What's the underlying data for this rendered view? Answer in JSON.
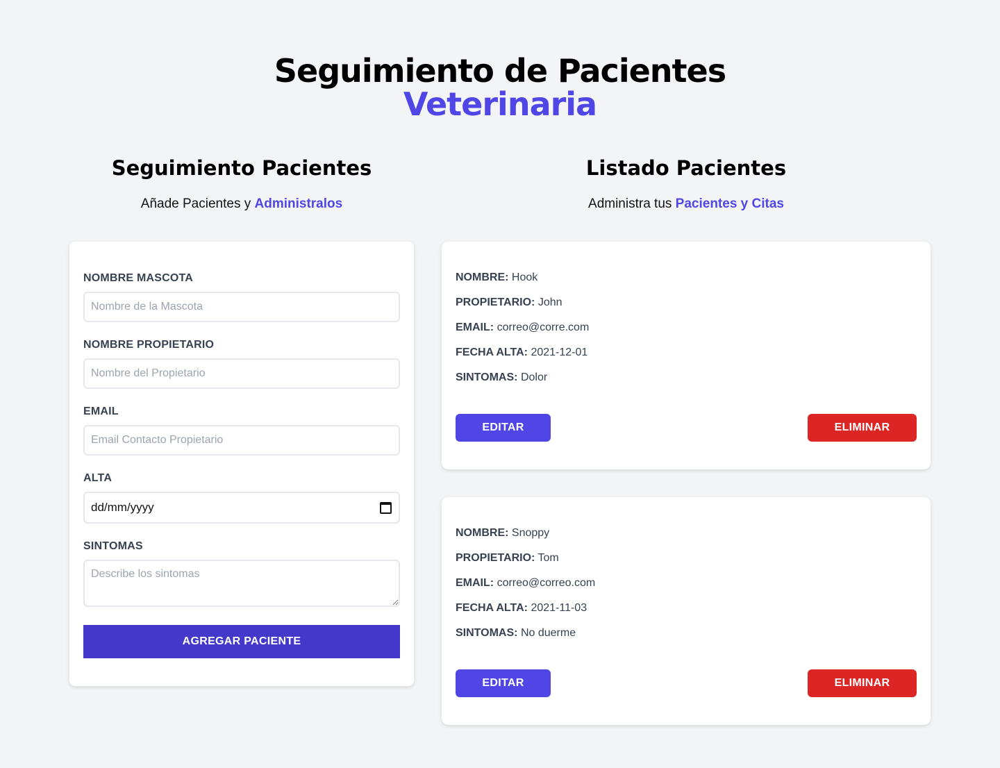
{
  "header": {
    "title_line1": "Seguimiento de Pacientes",
    "title_line2": "Veterinaria"
  },
  "form_section": {
    "title": "Seguimiento Pacientes",
    "subtitle_prefix": "Añade Pacientes y ",
    "subtitle_highlight": "Administralos"
  },
  "list_section": {
    "title": "Listado Pacientes",
    "subtitle_prefix": "Administra tus ",
    "subtitle_highlight": "Pacientes y Citas"
  },
  "form": {
    "pet_label": "NOMBRE MASCOTA",
    "pet_placeholder": "Nombre de la Mascota",
    "owner_label": "NOMBRE PROPIETARIO",
    "owner_placeholder": "Nombre del Propietario",
    "email_label": "EMAIL",
    "email_placeholder": "Email Contacto Propietario",
    "date_label": "ALTA",
    "date_value": "dd/mm/yyyy",
    "symptoms_label": "SINTOMAS",
    "symptoms_placeholder": "Describe los sintomas",
    "submit_label": "AGREGAR PACIENTE"
  },
  "field_keys": {
    "name": "Nombre:",
    "owner": "Propietario:",
    "email": "Email:",
    "date": "Fecha Alta:",
    "symptoms": "Sintomas:"
  },
  "patients": [
    {
      "name": "Hook",
      "owner": "John",
      "email": "correo@corre.com",
      "date": "2021-12-01",
      "symptoms": "Dolor",
      "edit_label": "Editar",
      "delete_label": "Eliminar"
    },
    {
      "name": "Snoppy",
      "owner": "Tom",
      "email": "correo@correo.com",
      "date": "2021-11-03",
      "symptoms": "No duerme",
      "edit_label": "Editar",
      "delete_label": "Eliminar"
    }
  ],
  "colors": {
    "background": "#f3f4f6",
    "accent": "#4f46e5",
    "submit": "#4338ca",
    "danger": "#dc2626"
  }
}
